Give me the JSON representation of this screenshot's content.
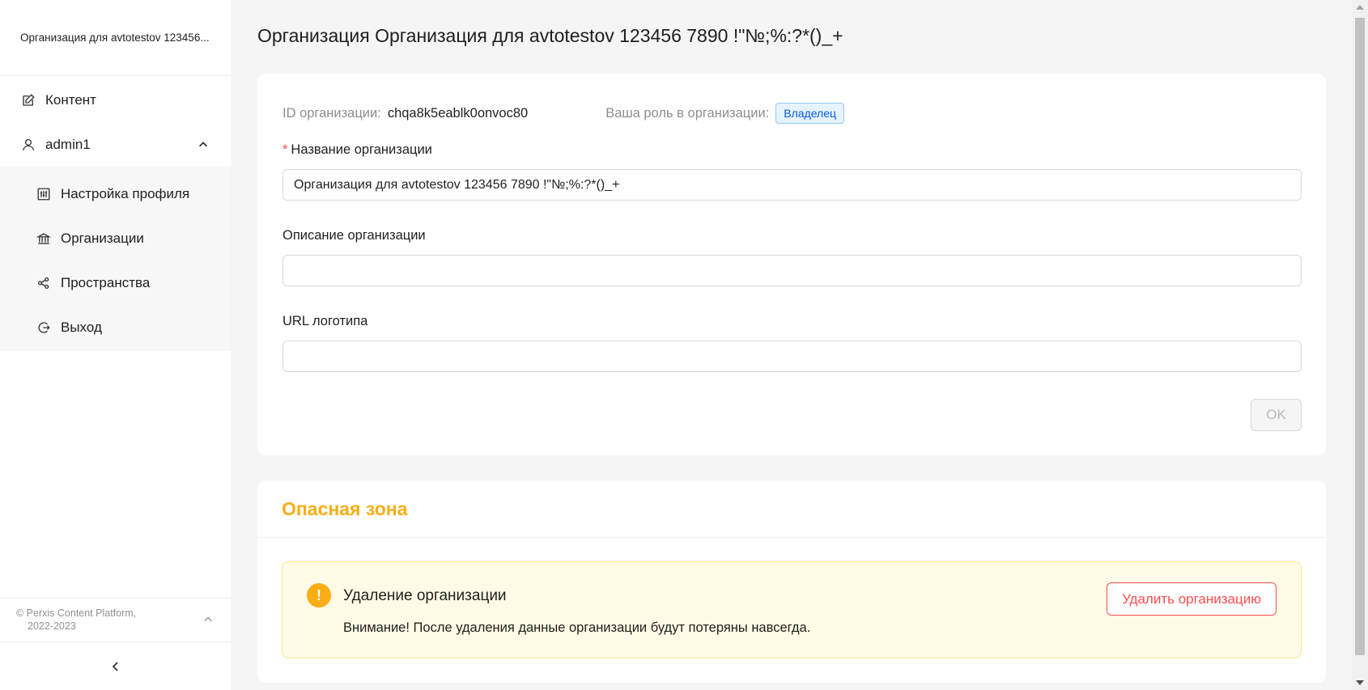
{
  "sidebar": {
    "org_name": "Организация для avtotestov 123456...",
    "menu": {
      "content": "Контент",
      "user": "admin1",
      "profile_settings": "Настройка профиля",
      "organizations": "Организации",
      "spaces": "Пространства",
      "logout": "Выход"
    },
    "footer": {
      "line1": "© Perxis Content Platform,",
      "line2": "2022-2023"
    }
  },
  "page": {
    "title": "Организация Организация для avtotestov 123456 7890 !\"№;%:?*()_+"
  },
  "org_form": {
    "id_label": "ID организации:",
    "id_value": "chqa8k5eablk0onvoc80",
    "role_label": "Ваша роль в организации:",
    "role_value": "Владелец",
    "name_label": "Название организации",
    "name_value": "Организация для avtotestov 123456 7890 !\"№;%:?*()_+",
    "description_label": "Описание организации",
    "description_value": "",
    "logo_label": "URL логотипа",
    "logo_value": "",
    "ok_label": "OK"
  },
  "danger_zone": {
    "title": "Опасная зона",
    "alert_title": "Удаление организации",
    "alert_desc": "Внимание! После удаления данные организации будут потеряны навсегда.",
    "delete_button": "Удалить организацию"
  },
  "colors": {
    "warning": "#faad14",
    "danger": "#ff4d4f",
    "tag_blue": "#0958d9"
  }
}
